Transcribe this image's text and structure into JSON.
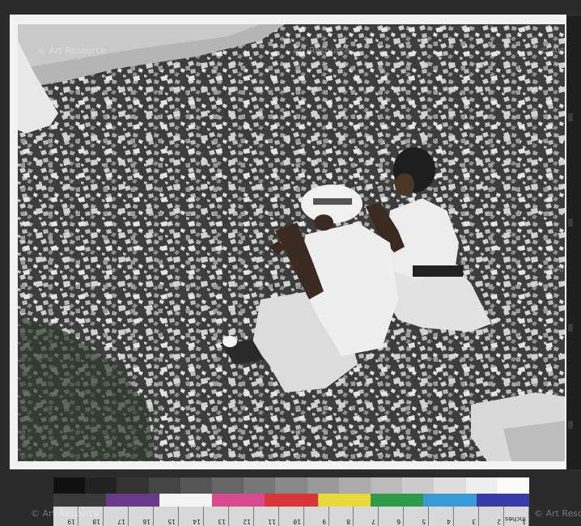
{
  "watermarks": [
    "© Art Resource",
    "Art Resource",
    "© Art Resource",
    "© Art Resource, NY",
    "© Art Resource",
    "© Art Resource"
  ],
  "ruler": {
    "labels": [
      "1",
      "2",
      "3",
      "4",
      "5",
      "6",
      "7",
      "8",
      "9",
      "10",
      "11",
      "12",
      "13",
      "14",
      "15",
      "16",
      "17",
      "18",
      "19"
    ],
    "unit": "inches",
    "lower_labels": [
      "1",
      "2",
      "3",
      "4",
      "5",
      "6",
      "7",
      "8"
    ]
  },
  "colors": {
    "background": "#2b2b2b",
    "print_border": "#f2f2f2",
    "patch_red": "#d8353a",
    "patch_magenta": "#d84a8f",
    "patch_purple": "#6a3a8a",
    "patch_yellow": "#e8d83a",
    "patch_green": "#2f9a4a",
    "patch_cyan": "#3a9ad8",
    "patch_blue": "#3a3aa8"
  }
}
